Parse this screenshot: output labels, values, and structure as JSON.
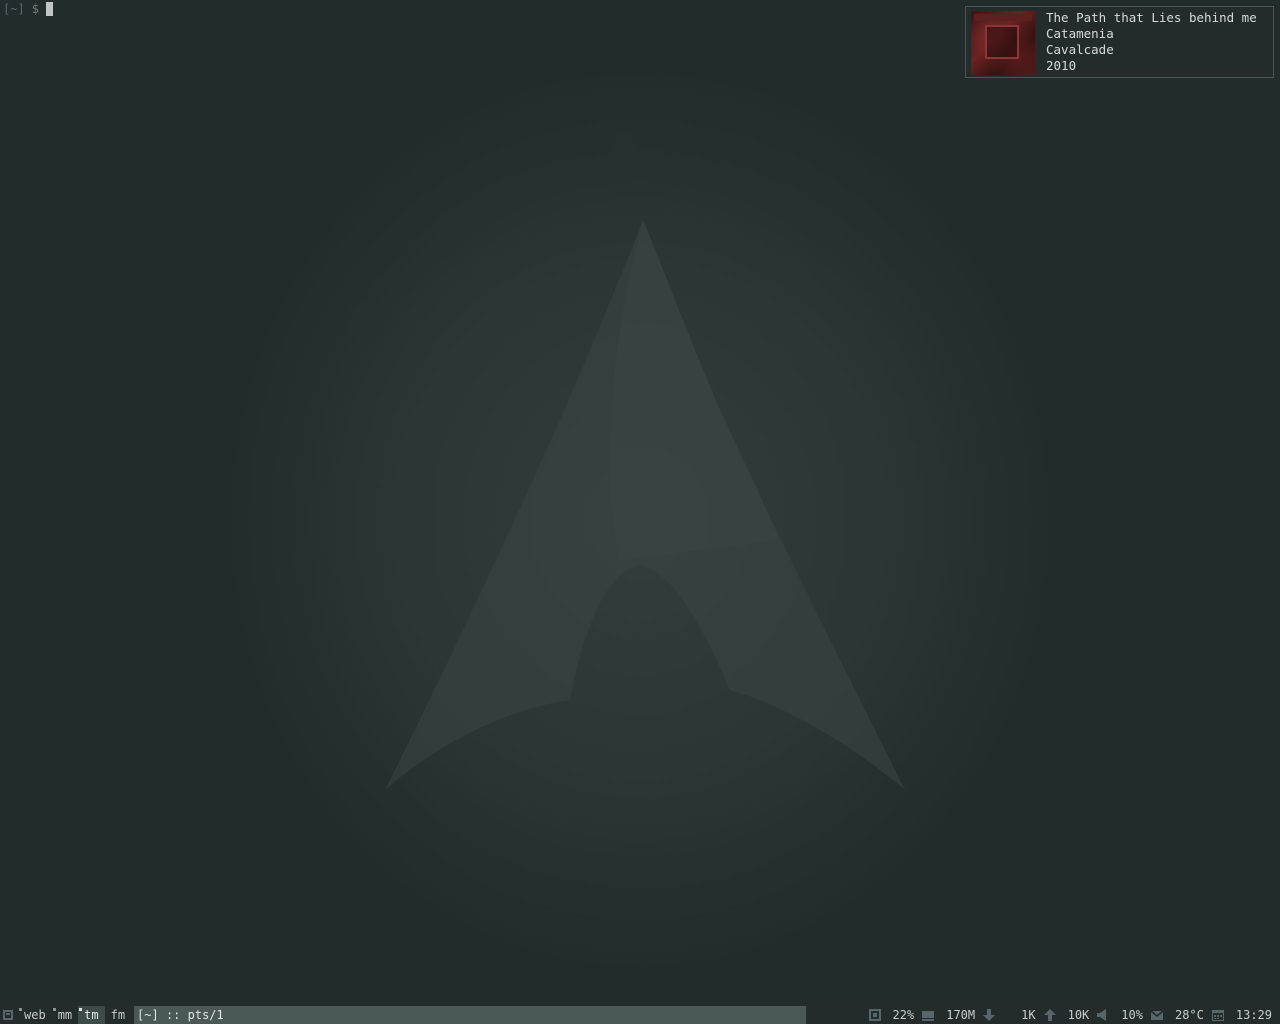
{
  "terminal": {
    "cwd": "[~]",
    "prompt_symbol": "$"
  },
  "now_playing": {
    "cover_icon": "album-cover",
    "title": "The Path that Lies behind me",
    "artist": "Catamenia",
    "album": "Cavalcade",
    "year": "2010"
  },
  "statusbar": {
    "layout_icon": "layout-icon",
    "workspaces": [
      {
        "label": "web",
        "active": false
      },
      {
        "label": "mm",
        "active": false
      },
      {
        "label": "tm",
        "active": true
      },
      {
        "label": "fm",
        "active": false
      }
    ],
    "window_title": "[~] :: pts/1",
    "cpu": "22%",
    "memory": "170M",
    "download": "1K",
    "upload": "10K",
    "volume": "10%",
    "temperature": "28°C",
    "clock": "13:29"
  },
  "colors": {
    "background": "#232d2d",
    "bar": "#232b2b",
    "title_bg": "#4a5858",
    "icon": "#56666a"
  }
}
